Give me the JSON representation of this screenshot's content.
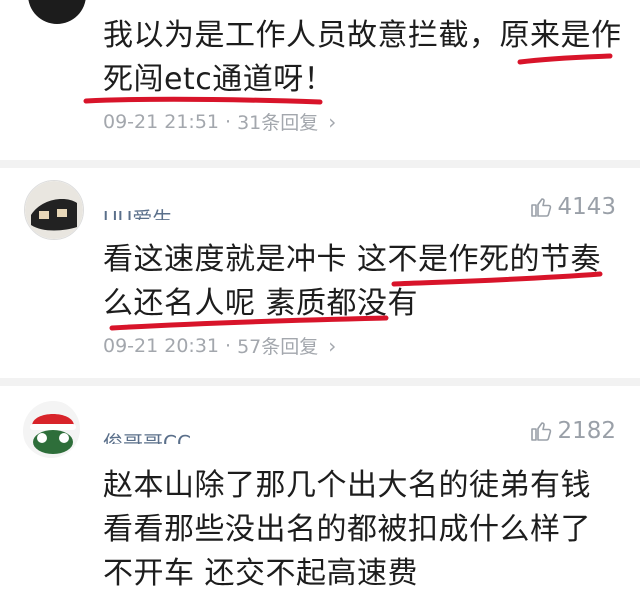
{
  "comments": [
    {
      "text": "我以为是工作人员故意拦截，原来是作死闯etc通道呀！",
      "time": "09-21 21:51",
      "replies": "31条回复"
    },
    {
      "username": "UU爱生",
      "likes": "4143",
      "text": "看这速度就是冲卡  这不是作死的节奏么还名人呢  素质都没有",
      "time": "09-21 20:31",
      "replies": "57条回复"
    },
    {
      "username": "俊哥哥CC",
      "likes": "2182",
      "text": "赵本山除了那几个出大名的徒弟有钱  看看那些没出名的都被扣成什么样了  不开车  还交不起高速费"
    }
  ],
  "separator": "·",
  "colors": {
    "annotation_red": "#d8142a",
    "meta_gray": "#a3a7ad",
    "username_blue": "#5a6f8a"
  },
  "icons": [
    "thumb-up-icon",
    "chevron-right-icon"
  ]
}
